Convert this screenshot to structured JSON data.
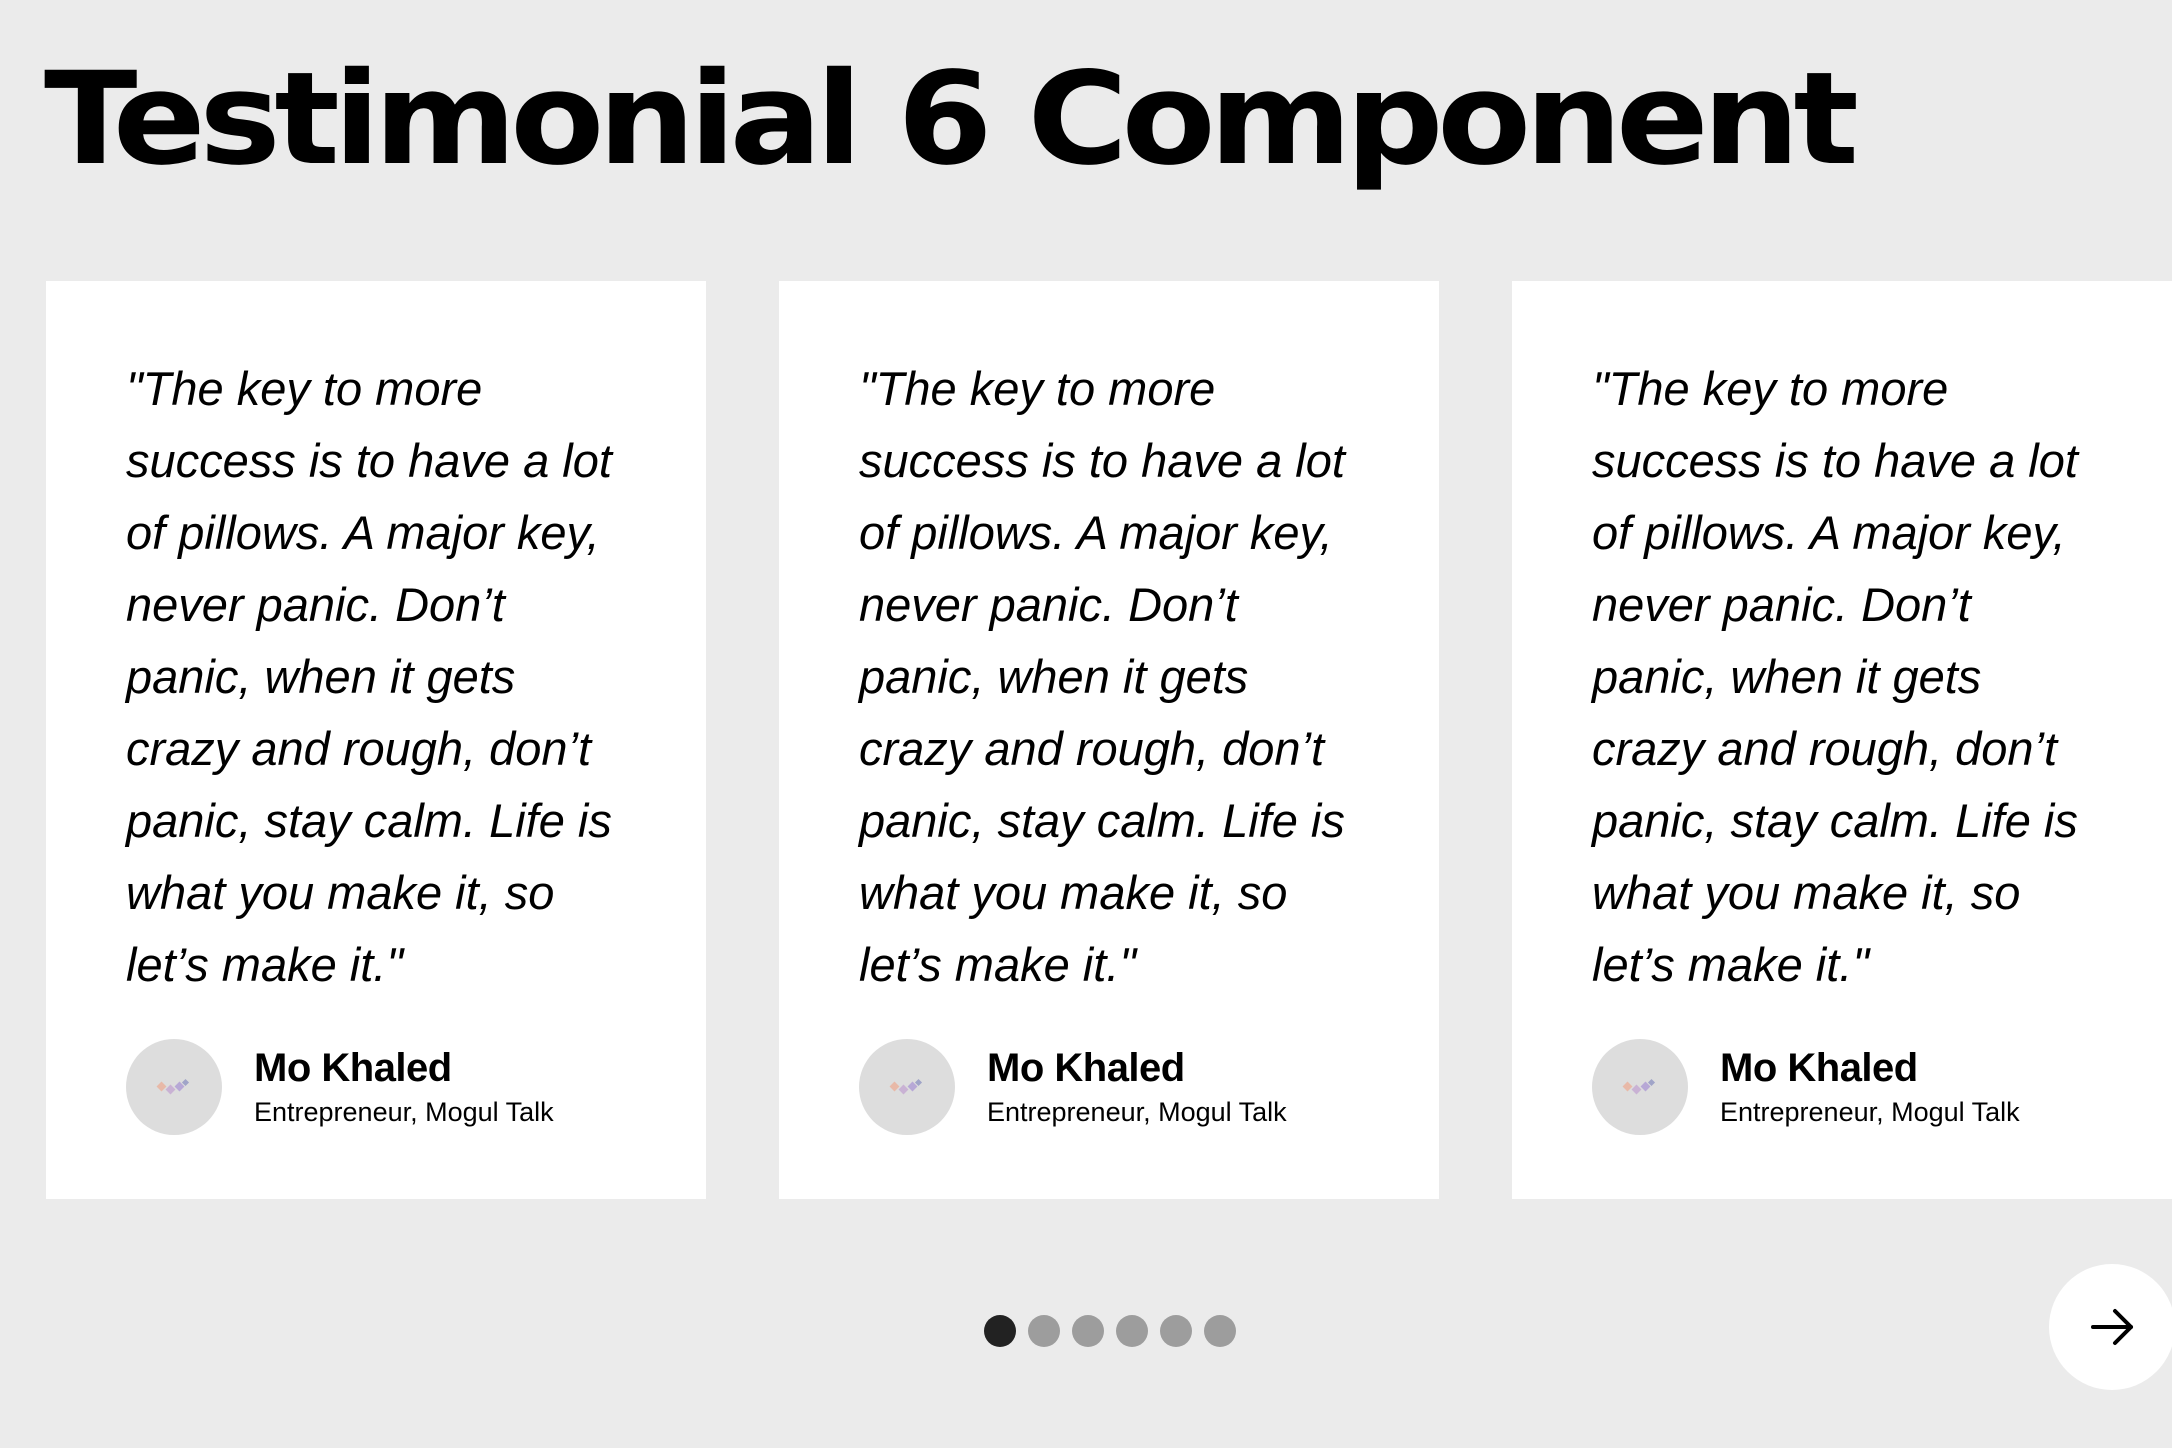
{
  "page": {
    "title": "Testimonial 6 Component"
  },
  "testimonials": [
    {
      "quote": "\"The key to more success is to have a lot of pillows. A major key, never panic. Don’t panic, when it gets crazy and rough, don’t panic, stay calm. Life is what you make it, so let’s make it.\"",
      "name": "Mo Khaled",
      "role": "Entrepreneur, Mogul Talk",
      "avatar_icon": "logo-icon"
    },
    {
      "quote": "\"The key to more success is to have a lot of pillows. A major key, never panic. Don’t panic, when it gets crazy and rough, don’t panic, stay calm. Life is what you make it, so let’s make it.\"",
      "name": "Mo Khaled",
      "role": "Entrepreneur, Mogul Talk",
      "avatar_icon": "logo-icon"
    },
    {
      "quote": "\"The key to more success is to have a lot of pillows. A major key, never panic. Don’t panic, when it gets crazy and rough, don’t panic, stay calm. Life is what you make it, so let’s make it.\"",
      "name": "Mo Khaled",
      "role": "Entrepreneur, Mogul Talk",
      "avatar_icon": "logo-icon"
    }
  ],
  "pagination": {
    "count": 6,
    "active_index": 0
  },
  "navigation": {
    "next_icon": "arrow-right-icon"
  },
  "colors": {
    "background": "#ebebeb",
    "card": "#ffffff",
    "dot_active": "#222222",
    "dot_inactive": "#9d9d9d",
    "avatar_bg": "#dddddd"
  }
}
